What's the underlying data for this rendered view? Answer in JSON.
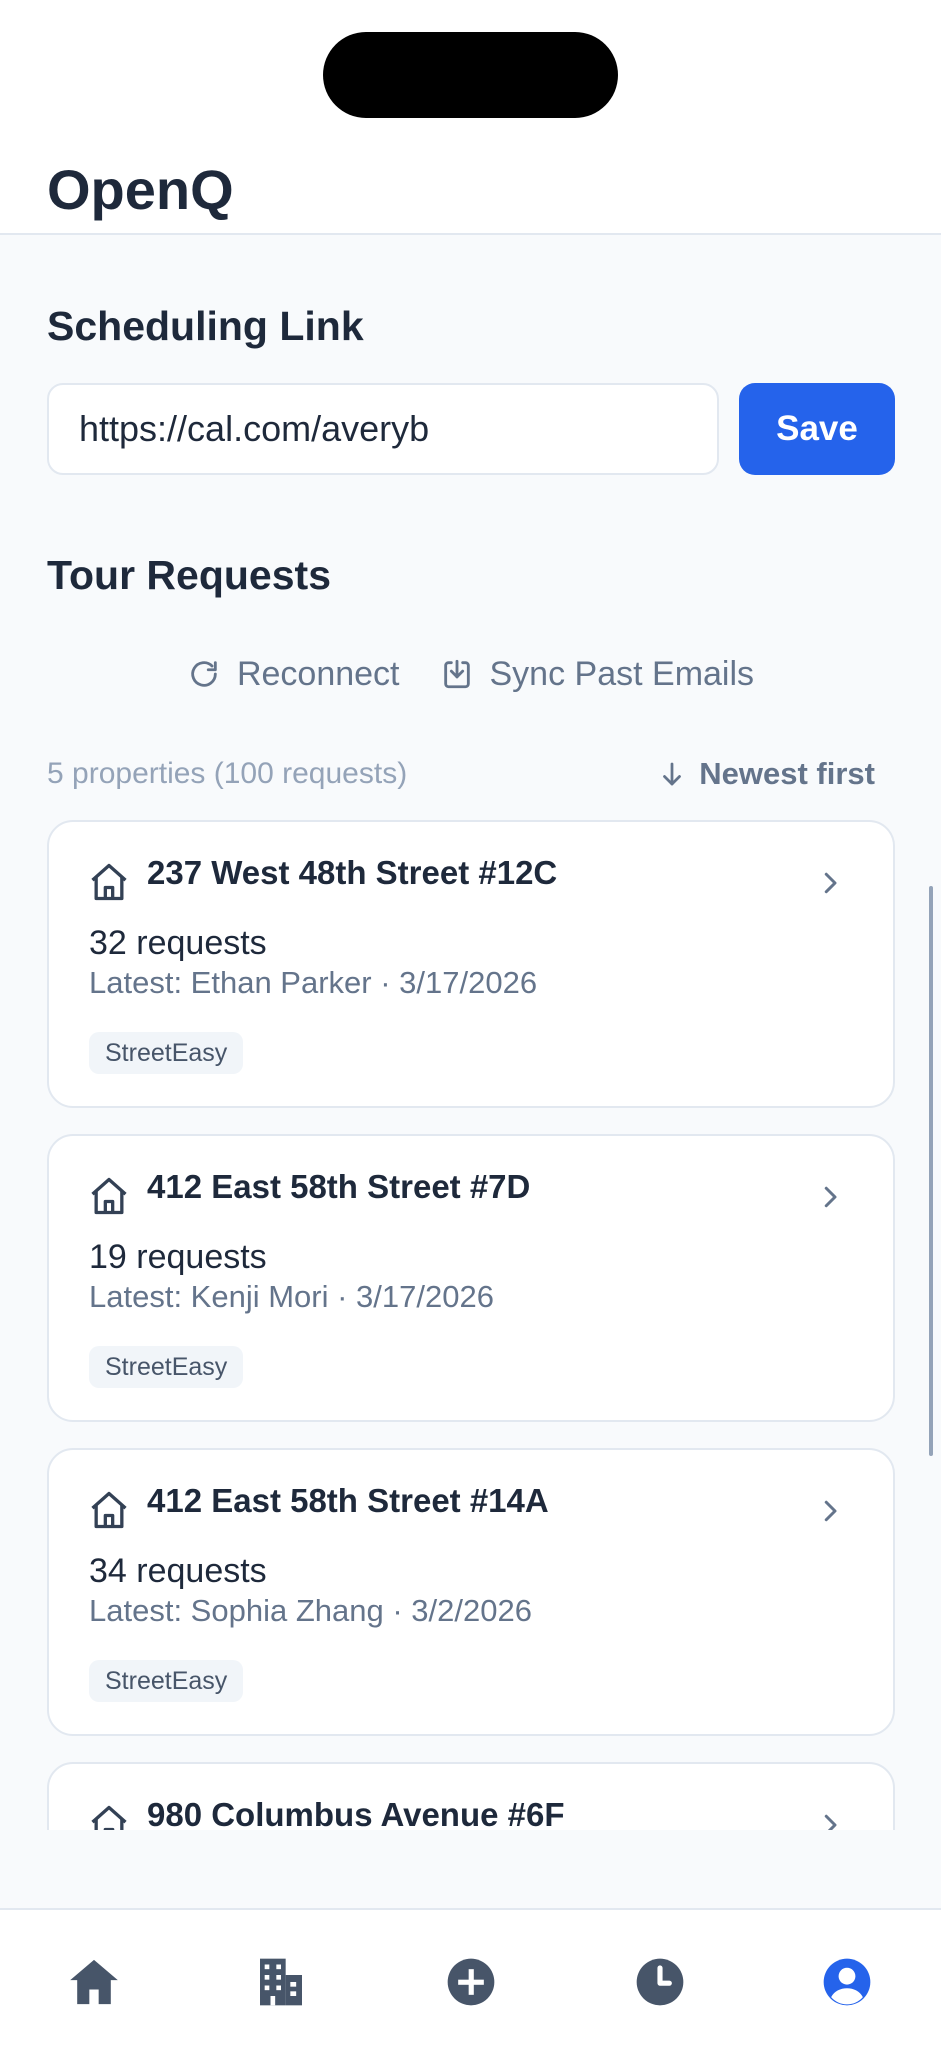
{
  "app": {
    "title": "OpenQ"
  },
  "scheduling": {
    "title": "Scheduling Link",
    "link_value": "https://cal.com/averyb",
    "save_label": "Save"
  },
  "tour_requests": {
    "title": "Tour Requests",
    "reconnect_label": "Reconnect",
    "sync_label": "Sync Past Emails",
    "summary": "5 properties (100 requests)",
    "sort_label": "Newest first",
    "properties": [
      {
        "address": "237 West 48th Street #12C",
        "count_text": "32 requests",
        "latest_text": "Latest: Ethan Parker · 3/17/2026",
        "source": "StreetEasy"
      },
      {
        "address": "412 East 58th Street #7D",
        "count_text": "19 requests",
        "latest_text": "Latest: Kenji Mori · 3/17/2026",
        "source": "StreetEasy"
      },
      {
        "address": "412 East 58th Street #14A",
        "count_text": "34 requests",
        "latest_text": "Latest: Sophia Zhang · 3/2/2026",
        "source": "StreetEasy"
      },
      {
        "address": "980 Columbus Avenue #6F"
      }
    ]
  },
  "bottom_nav": {
    "items": [
      {
        "icon": "home-icon",
        "active": false
      },
      {
        "icon": "building-icon",
        "active": false
      },
      {
        "icon": "plus-circle-icon",
        "active": false
      },
      {
        "icon": "clock-icon",
        "active": false
      },
      {
        "icon": "user-circle-icon",
        "active": true
      }
    ]
  },
  "colors": {
    "accent": "#2563eb",
    "text_primary": "#1e293b",
    "text_secondary": "#64748b",
    "nav_inactive": "#475569",
    "badge_bg": "#f1f5f9"
  }
}
